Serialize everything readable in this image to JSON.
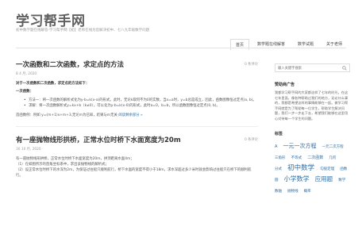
{
  "site": {
    "title": "学习帮手网",
    "description": "初中数学题在线解答-学习帮手网【初】老师在线为您解决初中、七八九年级数学问题"
  },
  "nav": {
    "items": [
      {
        "label": "首页",
        "active": true
      },
      {
        "label": "数学题在线解答",
        "active": false
      },
      {
        "label": "数学试题",
        "active": false
      },
      {
        "label": "关于老师",
        "active": false
      }
    ]
  },
  "posts": [
    {
      "title": "一次函数和二次函数，求定点的方法",
      "date": "8 4 月, 2020",
      "comments": "0 条评论",
      "intro": "对于一次函数和二次函数，求定点的方法如下：",
      "subheading": "一次函数：",
      "bullets": [
        "方法一：将一次函数的解析式化为y-b=k(x-a)的形式，此时，无论k取何不为0的实数，当x=a时，y=b总是成立，因此，函数图像恒过定点(a, b)。",
        "求解：将一次函数解析式y=kx+b（k≠0），可以化为y-b=k(x-0)的形式，此时a=0，b=b，所以函数图像恒过定点(0, b)。"
      ],
      "example": "首函数例：例如 y=(m+1)x+m+3,无论m为已知，结果与m无关",
      "readmore": "阅读剩余部分 »"
    },
    {
      "title": "有一座抛物线形拱桥，正常水位时桥下水面宽度为20m",
      "date": "30 10 月, 2020",
      "comments": "0 条评论",
      "lines": [
        "有一座抛物线形拱桥，正常水位时桥下水面宽度为20m，拱顶距离水面4m；",
        "（1）在如图所示的直角坐标系中，求出该抛物线的解析式；",
        "（2）设正常水位时桥下的水深为2m，为保证过往船只顺利航行，桥下水面的宽度不得小于18m，求水深超过多少米时就会影响过往船只在桥下的顺利航行。"
      ]
    }
  ],
  "sidebar": {
    "search_placeholder": "输入关键字搜索",
    "ad_title": "赞助商广告",
    "ad_text": "我都学习帮手网的大家都这样了七年的时光，在这七年里面，像各种帮助过我们的地方，无论什么事的，我都是希望这样的事情能够在一起。做学习帮手网就是为了帮助每一位学生，帮助学生解决问题，我们一步一步走下去，希望我们能够在这里用心对待每一个学生的问题。",
    "tags_title": "标签",
    "tags": [
      {
        "label": "A",
        "size": 5
      },
      {
        "label": "一元一次方程",
        "size": 7
      },
      {
        "label": "一元二次方程",
        "size": 4.5
      },
      {
        "label": "三角形",
        "size": 4.5
      },
      {
        "label": "不等式",
        "size": 4.5
      },
      {
        "label": "二次函数",
        "size": 5
      },
      {
        "label": "几何",
        "size": 4.5
      },
      {
        "label": "分式",
        "size": 4.5
      },
      {
        "label": "初中数学",
        "size": 8.5
      },
      {
        "label": "勾股定理",
        "size": 4.5
      },
      {
        "label": "函数",
        "size": 4.5
      },
      {
        "label": "圆",
        "size": 4.5
      },
      {
        "label": "小学数学",
        "size": 8
      },
      {
        "label": "应用题",
        "size": 7.5
      },
      {
        "label": "数学",
        "size": 4.5
      },
      {
        "label": "数轴",
        "size": 4.5
      },
      {
        "label": "抛物线",
        "size": 4.5
      },
      {
        "label": "概率",
        "size": 4.5
      }
    ]
  }
}
